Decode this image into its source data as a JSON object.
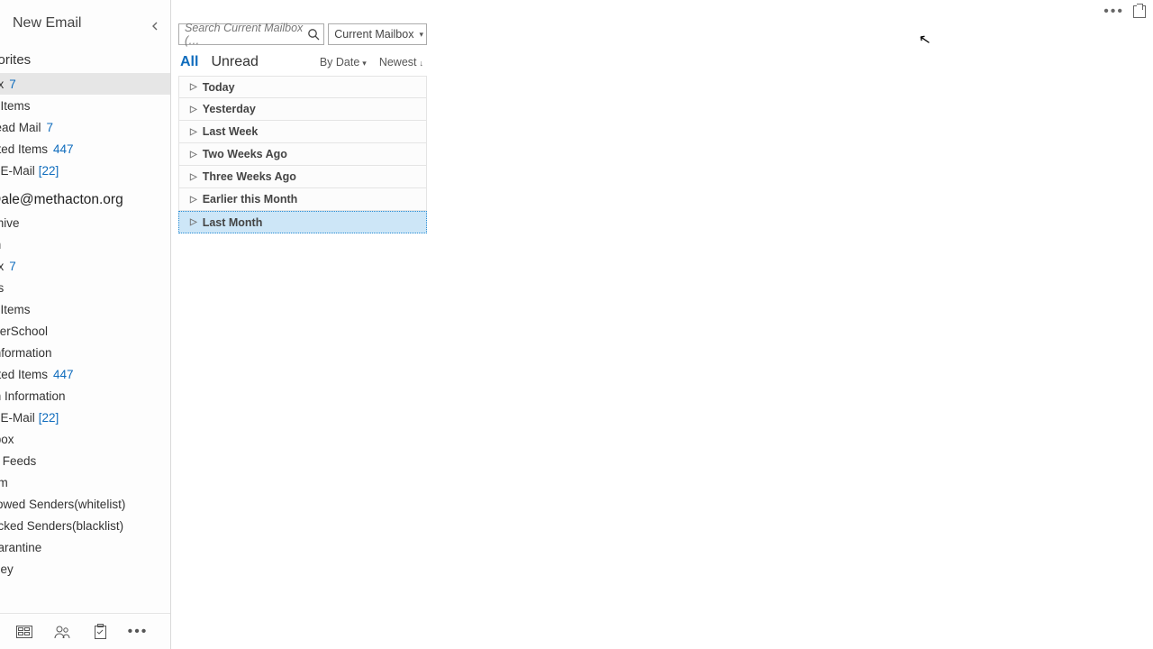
{
  "header": {
    "new_email": "New Email"
  },
  "favorites": {
    "title": "vorites",
    "items": [
      {
        "label": "ox",
        "count": "7",
        "selected": true
      },
      {
        "label": "it Items"
      },
      {
        "label": "read Mail",
        "count": "7"
      },
      {
        "label": "eted Items",
        "count": "447"
      },
      {
        "label": "k E-Mail",
        "bracket_count": "[22]"
      }
    ]
  },
  "account": {
    "title": "Dale@methacton.org",
    "items": [
      {
        "label": "chive"
      },
      {
        "label": "m"
      },
      {
        "label": "ox",
        "count": "7"
      },
      {
        "label": "fts"
      },
      {
        "label": "it Items"
      },
      {
        "label": "werSchool"
      },
      {
        "label": "Information"
      },
      {
        "label": "eted Items",
        "count": "447"
      },
      {
        "label": "th Information"
      },
      {
        "label": "k E-Mail",
        "bracket_count": "[22]"
      },
      {
        "label": "tbox"
      },
      {
        "label": "S Feeds"
      },
      {
        "label": "am"
      },
      {
        "label": "llowed Senders(whitelist)"
      },
      {
        "label": "ocked Senders(blacklist)"
      },
      {
        "label": "uarantine"
      },
      {
        "label": "lney"
      }
    ]
  },
  "search": {
    "placeholder": "Search Current Mailbox (…",
    "scope": "Current Mailbox"
  },
  "filters": {
    "all": "All",
    "unread": "Unread",
    "sort_by": "By Date",
    "order": "Newest"
  },
  "groups": [
    {
      "label": "Today"
    },
    {
      "label": "Yesterday"
    },
    {
      "label": "Last Week"
    },
    {
      "label": "Two Weeks Ago"
    },
    {
      "label": "Three Weeks Ago"
    },
    {
      "label": "Earlier this Month"
    },
    {
      "label": "Last Month",
      "selected": true
    }
  ]
}
